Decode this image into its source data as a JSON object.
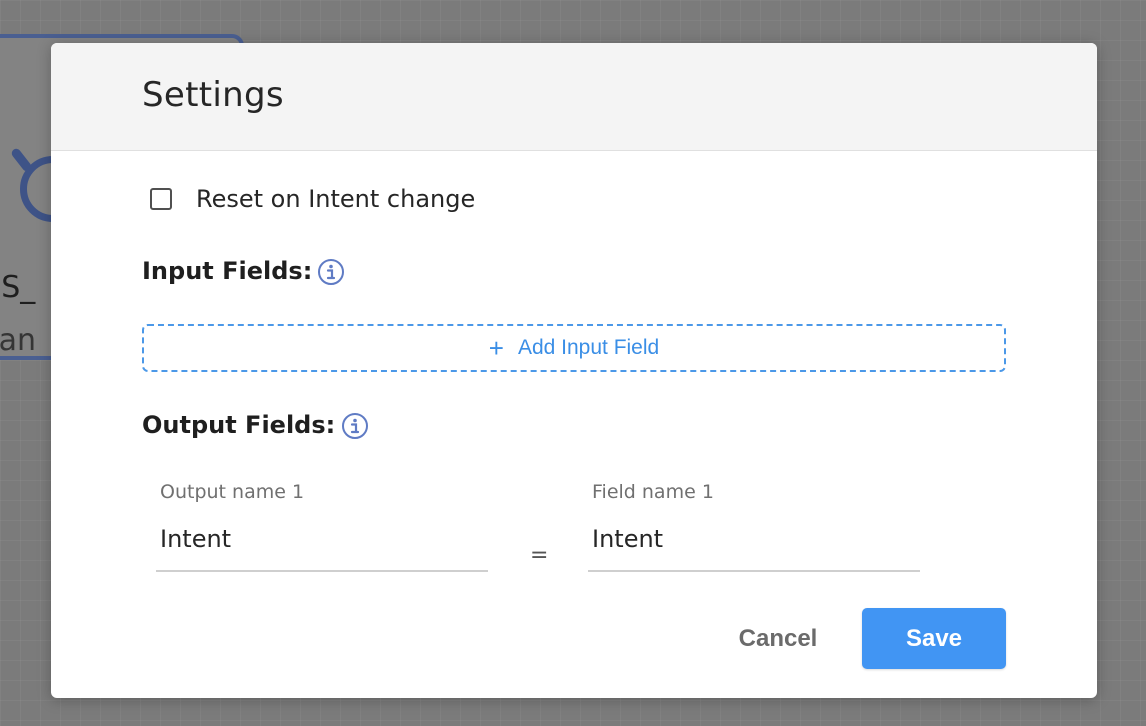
{
  "background_node": {
    "title_fragment": "GS_",
    "subtitle_fragment": "Ban"
  },
  "modal": {
    "title": "Settings",
    "reset_checkbox": {
      "label": "Reset on Intent change",
      "checked": false
    },
    "input_fields": {
      "label": "Input Fields:",
      "info_icon": "info-circle-icon",
      "add_button": {
        "icon": "plus-icon",
        "label": "Add Input Field"
      }
    },
    "output_fields": {
      "label": "Output Fields:",
      "info_icon": "info-circle-icon",
      "rows": [
        {
          "output_label": "Output name 1",
          "output_value": "Intent",
          "separator": "=",
          "field_label": "Field name 1",
          "field_value": "Intent"
        }
      ]
    },
    "footer": {
      "cancel_label": "Cancel",
      "save_label": "Save"
    }
  },
  "colors": {
    "accent": "#4195f3",
    "link": "#3a8ee6",
    "info_icon": "#5f7bc4",
    "overlay": "#7b7b7b",
    "node_border": "#4a5f91"
  }
}
